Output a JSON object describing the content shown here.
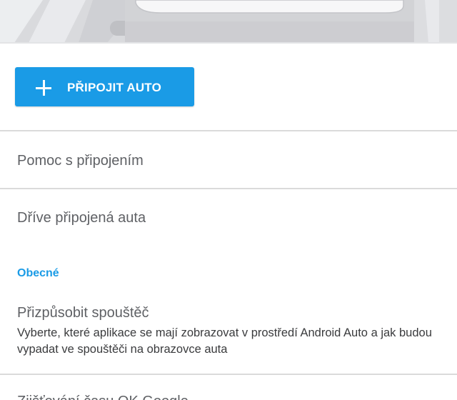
{
  "connect_button": {
    "label": "PŘIPOJIT AUTO",
    "icon": "plus-icon",
    "color": "#1a9be6"
  },
  "items": [
    {
      "title": "Pomoc s připojením"
    },
    {
      "title": "Dříve připojená auta"
    }
  ],
  "general_section": {
    "header": "Obecné",
    "customize_launcher": {
      "title": "Přizpůsobit spouštěč",
      "subtitle": "Vyberte, které aplikace se mají zobrazovat v prostředí Android Auto a jak budou vypadat ve spouštěči na obrazovce auta"
    },
    "next_item_partial": {
      "title": "Zjišťování času OK Google"
    }
  },
  "colors": {
    "accent": "#1a9be6",
    "text_primary": "#5f6165",
    "text_secondary": "#3a3b3d",
    "divider": "#dadada"
  }
}
